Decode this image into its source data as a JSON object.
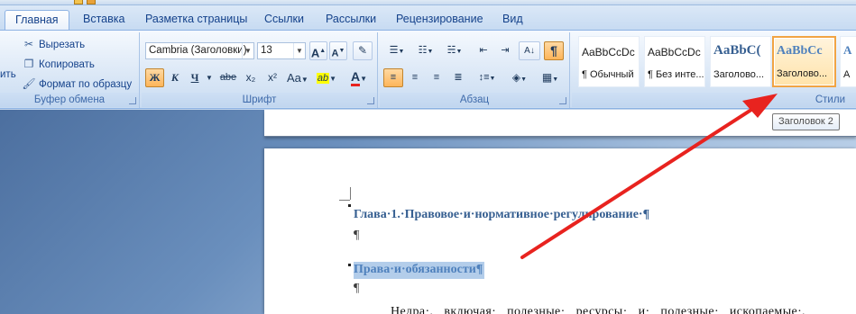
{
  "tabs": [
    "Главная",
    "Вставка",
    "Разметка страницы",
    "Ссылки",
    "Рассылки",
    "Рецензирование",
    "Вид"
  ],
  "clipboard": {
    "paste_partial": "ить",
    "cut": "Вырезать",
    "copy": "Копировать",
    "format_painter": "Формат по образцу",
    "label": "Буфер обмена"
  },
  "font": {
    "family": "Cambria (Заголовки)",
    "size": "13",
    "grow": "A",
    "shrink": "A",
    "bold": "Ж",
    "italic": "К",
    "underline": "Ч",
    "strike": "abe",
    "subscript": "x₂",
    "superscript": "x²",
    "case": "Aa",
    "highlight": "ab",
    "color": "A",
    "label": "Шрифт"
  },
  "paragraph": {
    "pilcrow": "¶",
    "sort": "А↓",
    "label": "Абзац"
  },
  "styles": {
    "items": [
      {
        "sample": "AaBbCcDc",
        "name": "¶ Обычный"
      },
      {
        "sample": "AaBbCcDc",
        "name": "¶ Без инте..."
      },
      {
        "sample": "AaBbC(",
        "name": "Заголово..."
      },
      {
        "sample": "AaBbCc",
        "name": "Заголово..."
      },
      {
        "sample": "A",
        "name": "A"
      }
    ],
    "label": "Стили",
    "tooltip": "Заголовок 2"
  },
  "document": {
    "heading1": "Глава·1.·Правовое·и·нормативное·регулирование·¶",
    "pilcrow1": "¶",
    "heading2": "Права·и·обязанности¶",
    "pilcrow2": "¶",
    "body_partial": "Недра·, включая· полезные· ресурсы· и· полезные· ископаемые·,"
  },
  "colors": {
    "accent_arrow": "#e8231f",
    "heading1": "#365f91",
    "heading2": "#4f81bd",
    "selection": "#b3cdea"
  }
}
